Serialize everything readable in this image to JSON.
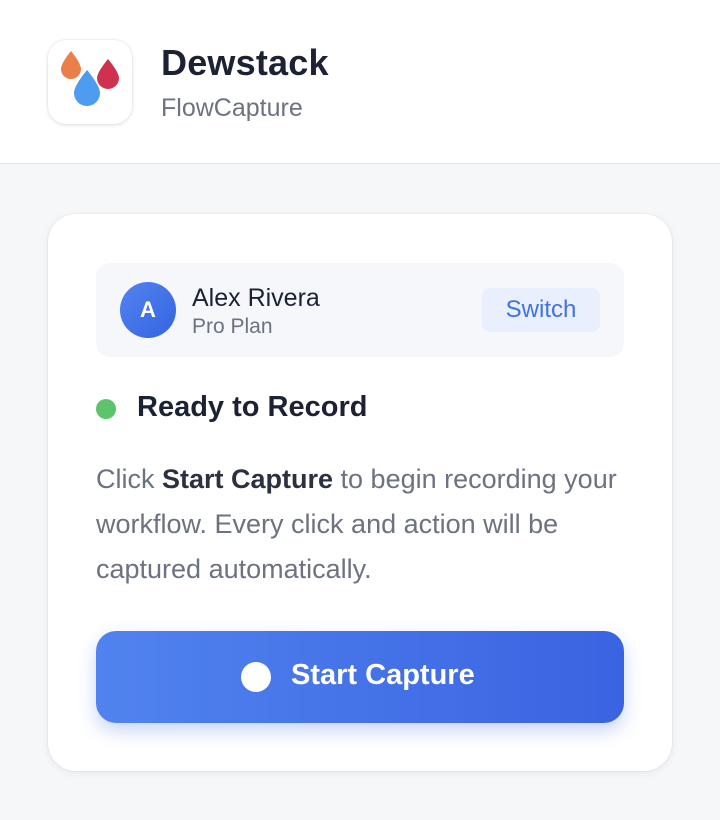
{
  "header": {
    "brand": "Dewstack",
    "product": "FlowCapture",
    "logo_icon": "water-drops-icon",
    "logo_colors": [
      "#e9804a",
      "#d0314f",
      "#4d9cf0"
    ]
  },
  "account": {
    "avatar_initial": "A",
    "name": "Alex Rivera",
    "plan": "Pro Plan",
    "switch_label": "Switch"
  },
  "status": {
    "text": "Ready to Record",
    "color": "#5cc46a"
  },
  "description": {
    "prefix": "Click ",
    "emphasis": "Start Capture",
    "suffix": " to begin recording your workflow. Every click and action will be captured automatically."
  },
  "capture_button": {
    "label": "Start Capture",
    "icon": "record-dot-icon",
    "color": "#4673e8"
  }
}
